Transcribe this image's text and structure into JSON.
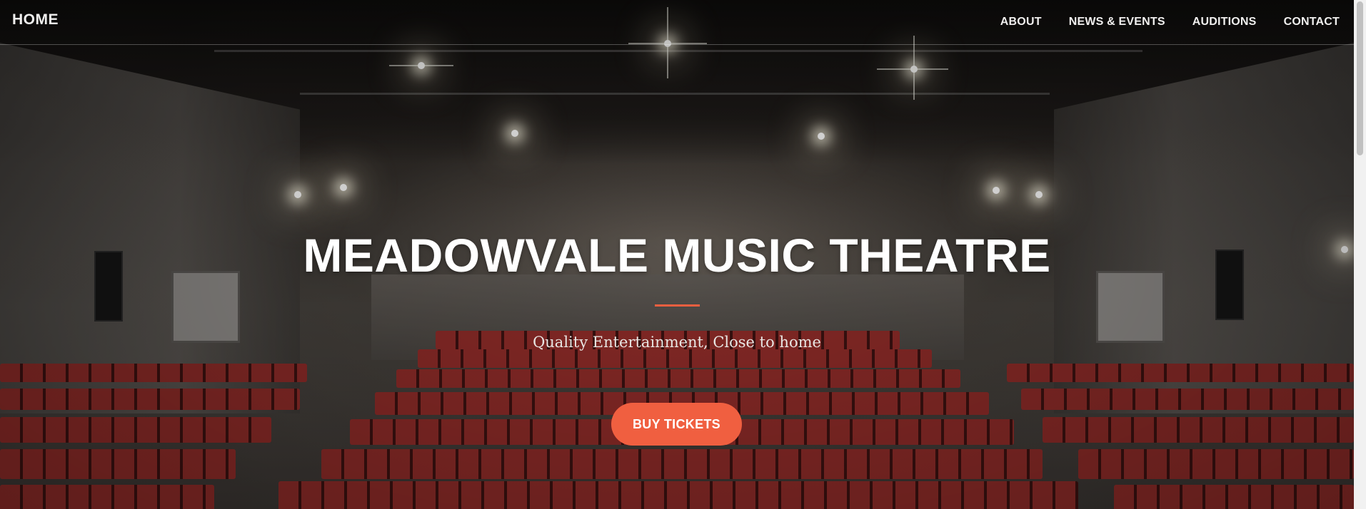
{
  "navbar": {
    "brand": "HOME",
    "links": [
      {
        "label": "ABOUT"
      },
      {
        "label": "NEWS & EVENTS"
      },
      {
        "label": "AUDITIONS"
      },
      {
        "label": "CONTACT"
      }
    ]
  },
  "hero": {
    "title": "MEADOWVALE MUSIC THEATRE",
    "tagline": "Quality Entertainment, Close to home",
    "cta_label": "BUY TICKETS"
  },
  "colors": {
    "accent": "#f05f40",
    "text": "#ffffff"
  }
}
